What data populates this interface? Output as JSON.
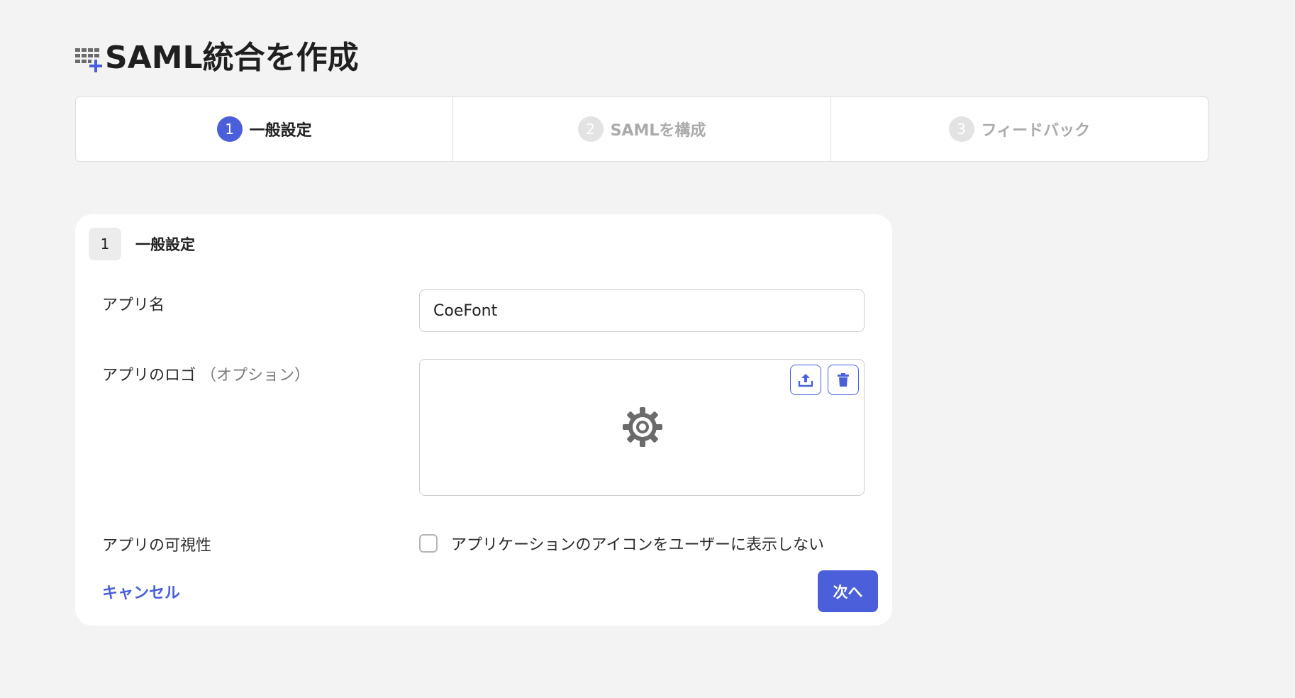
{
  "page": {
    "title": "SAML統合を作成"
  },
  "stepper": {
    "steps": [
      {
        "number": "1",
        "label": "一般設定",
        "state": "active"
      },
      {
        "number": "2",
        "label": "SAMLを構成",
        "state": "inactive"
      },
      {
        "number": "3",
        "label": "フィードバック",
        "state": "inactive"
      }
    ]
  },
  "section": {
    "badge": "1",
    "title": "一般設定"
  },
  "form": {
    "app_name": {
      "label": "アプリ名",
      "value": "CoeFont"
    },
    "app_logo": {
      "label": "アプリのロゴ",
      "optional": "（オプション）",
      "placeholder_icon": "gear-icon"
    },
    "visibility": {
      "label": "アプリの可視性",
      "checkbox_label": "アプリケーションのアイコンをユーザーに表示しない",
      "checked": false
    }
  },
  "actions": {
    "cancel": "キャンセル",
    "next": "次へ"
  },
  "colors": {
    "accent": "#4a5fd9",
    "background": "#f3f3f3",
    "step_inactive": "#e3e3e3"
  }
}
